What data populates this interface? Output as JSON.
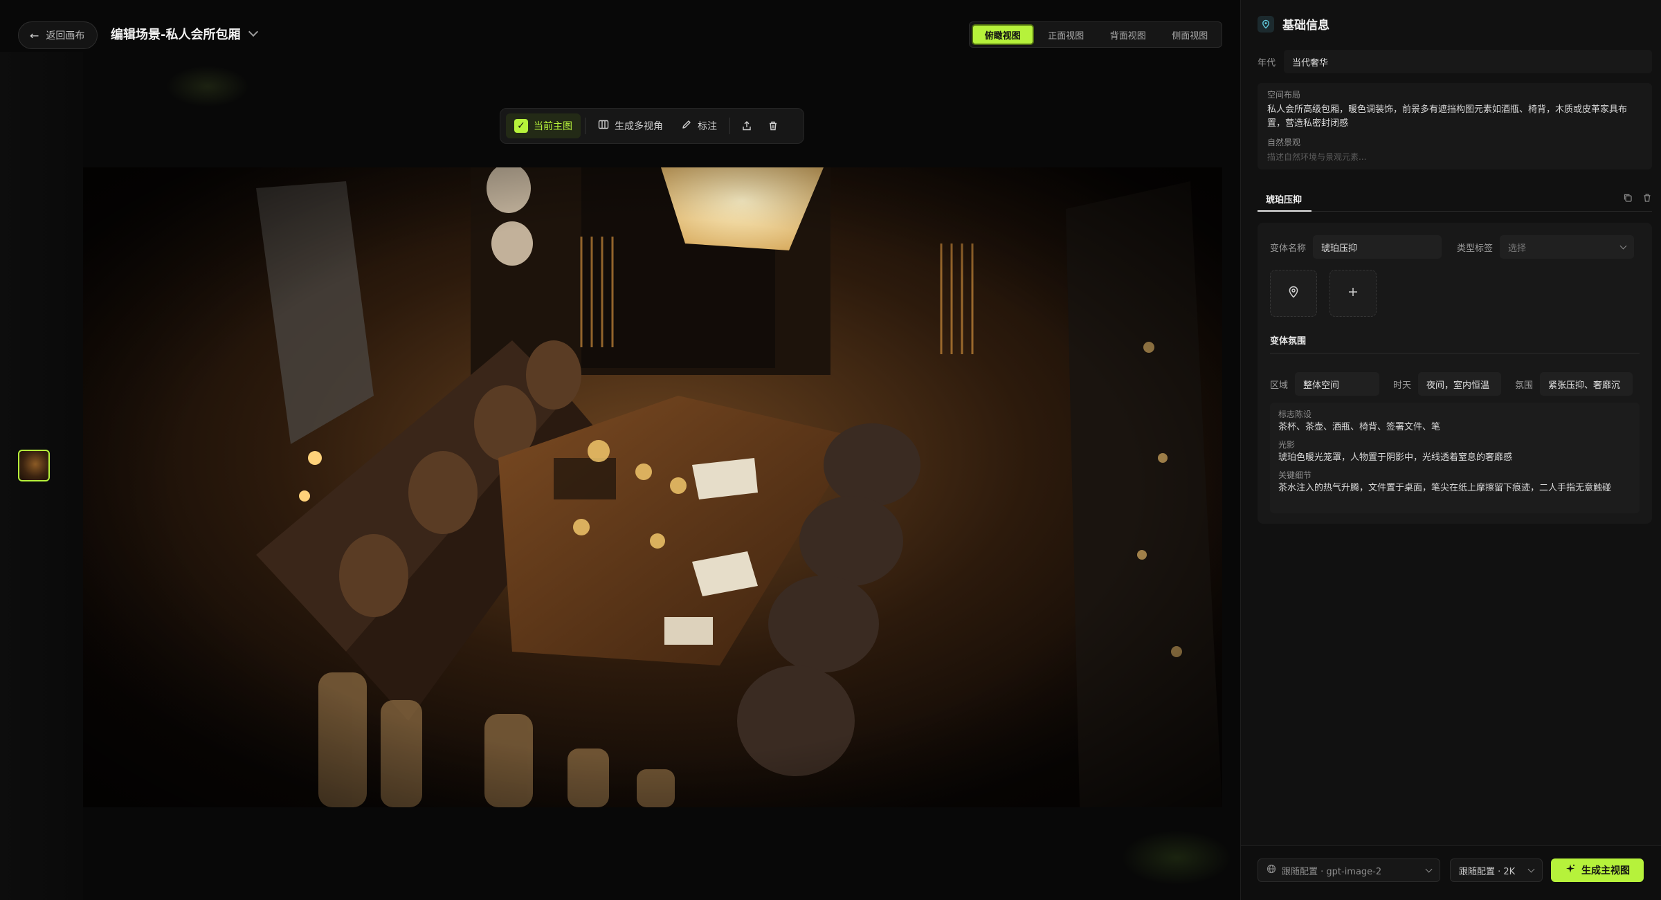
{
  "header": {
    "back_label": "返回画布",
    "scene_title": "编辑场景-私人会所包厢"
  },
  "view_tabs": [
    {
      "label": "俯瞰视图",
      "active": true
    },
    {
      "label": "正面视图",
      "active": false
    },
    {
      "label": "背面视图",
      "active": false
    },
    {
      "label": "侧面视图",
      "active": false
    }
  ],
  "image_toolbar": {
    "current_main": "当前主图",
    "multi_view": "生成多视角",
    "annotate": "标注"
  },
  "panel": {
    "title": "基础信息",
    "era_label": "年代",
    "era_value": "当代奢华",
    "layout_label": "空间布局",
    "layout_text": "私人会所高级包厢，暖色调装饰，前景多有遮挡构图元素如酒瓶、椅背，木质或皮革家具布置，营造私密封闭感",
    "landscape_label": "自然景观",
    "landscape_placeholder": "描述自然环境与景观元素..."
  },
  "variant": {
    "tab_label": "琥珀压抑",
    "name_label": "变体名称",
    "name_value": "琥珀压抑",
    "type_label": "类型标签",
    "type_placeholder": "选择",
    "atmosphere_title": "变体氛围",
    "region_label": "区域",
    "region_value": "整体空间",
    "time_label": "时天",
    "time_value": "夜间，室内恒温",
    "mood_label": "氛围",
    "mood_value": "紧张压抑、奢靡沉",
    "props_label": "标志陈设",
    "props_text": "茶杯、茶壶、酒瓶、椅背、签署文件、笔",
    "light_label": "光影",
    "light_text": "琥珀色暖光笼罩，人物置于阴影中，光线透着窒息的奢靡感",
    "key_label": "关键细节",
    "key_text": "茶水注入的热气升腾，文件置于桌面，笔尖在纸上摩擦留下痕迹，二人手指无意触碰"
  },
  "bottom": {
    "model_label": "跟随配置 · gpt-image-2",
    "res_label": "跟随配置 · 2K",
    "generate_label": "生成主视图"
  },
  "colors": {
    "accent": "#b6f23b",
    "panel_bg": "#111111",
    "canvas_bg": "#080808"
  }
}
